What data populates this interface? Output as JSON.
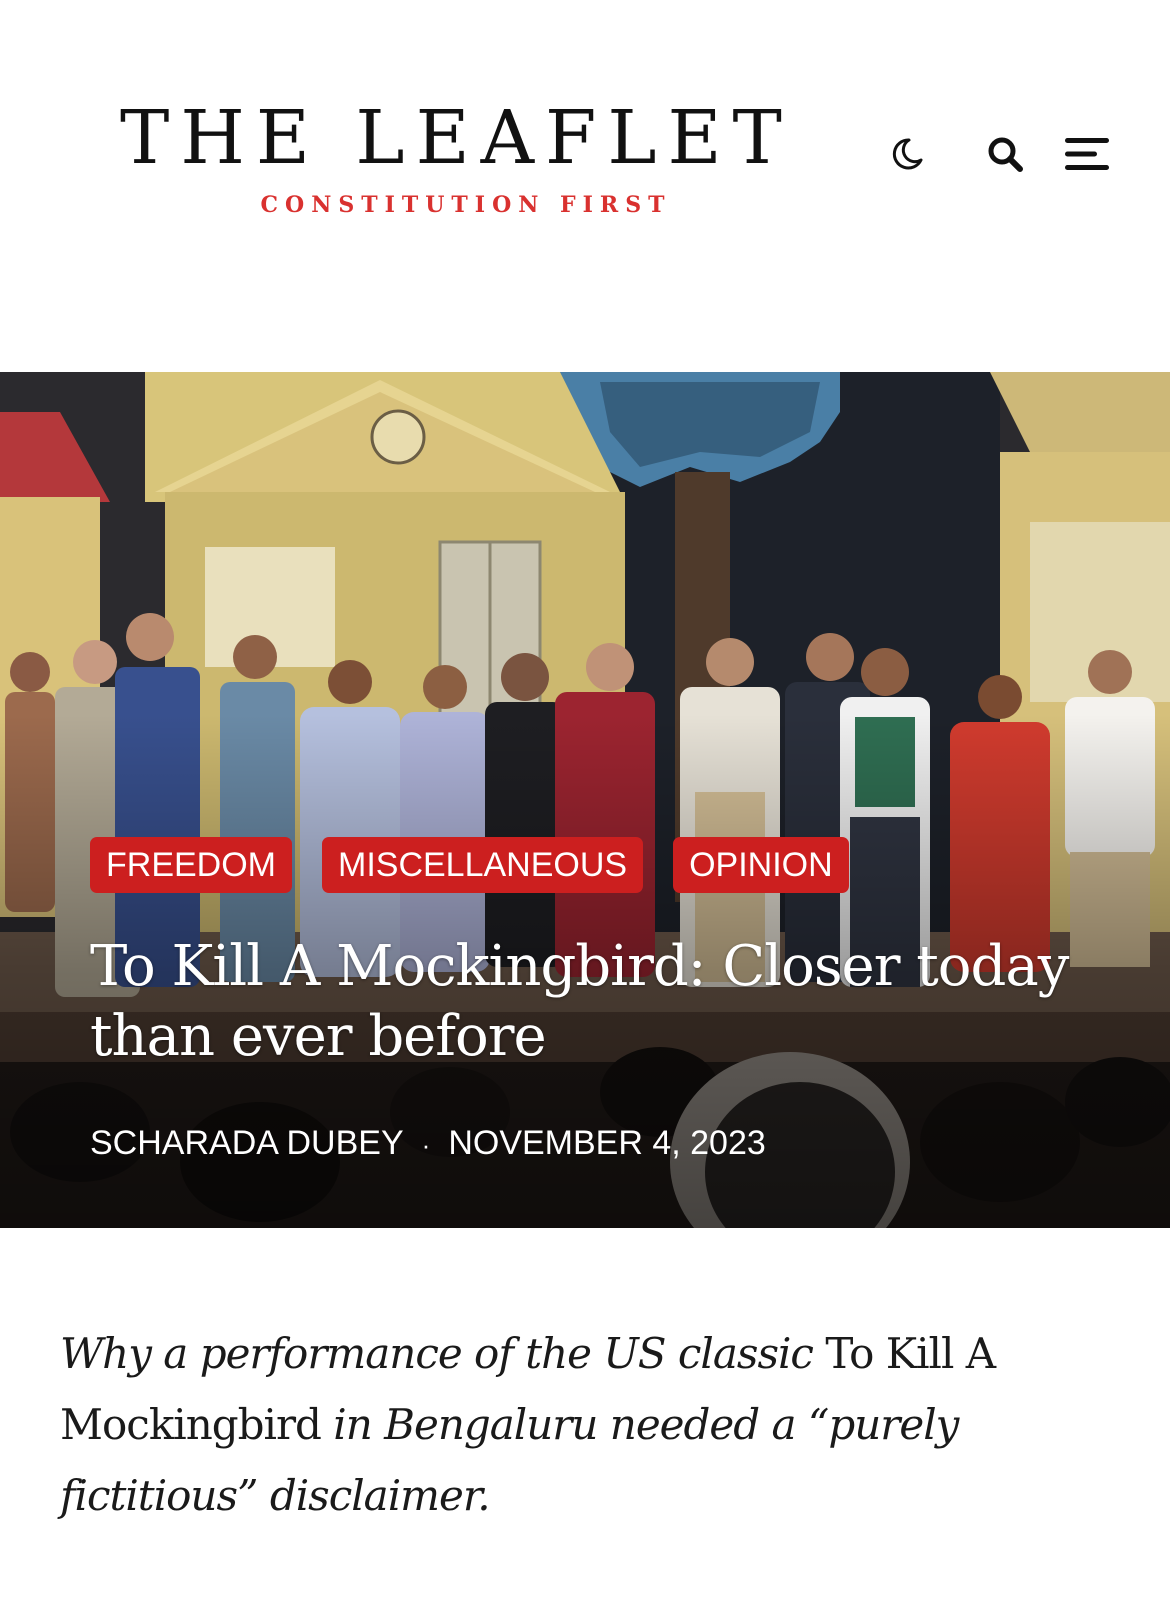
{
  "site": {
    "title": "THE LEAFLET",
    "tagline": "CONSTITUTION FIRST"
  },
  "header": {
    "icons": [
      "moon-icon",
      "search-icon",
      "hamburger-menu-icon"
    ]
  },
  "article": {
    "categories": [
      "FREEDOM",
      "MISCELLANEOUS",
      "OPINION"
    ],
    "title": "To Kill A Mockingbird: Closer today than ever before",
    "author": "SCHARADA DUBEY",
    "separator": "·",
    "date": "NOVEMBER 4, 2023",
    "dek": {
      "part1": "Why a performance of the US classic",
      "part2": "To Kill A Mockingbird",
      "part3": "in Bengaluru needed a “purely fictitious” disclaimer."
    }
  },
  "colors": {
    "accent": "#cc1f1f",
    "tagline": "#d9312f",
    "text": "#1a1a1a"
  }
}
